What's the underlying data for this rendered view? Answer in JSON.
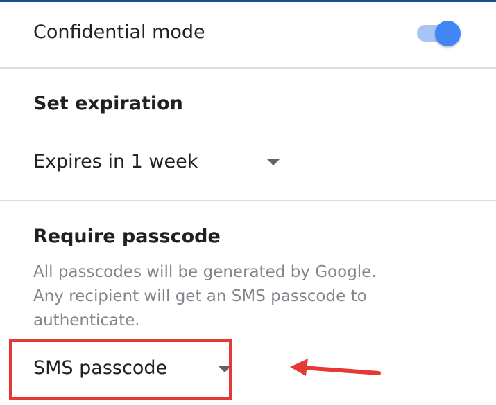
{
  "confidential_mode": {
    "label": "Confidential mode",
    "enabled": true
  },
  "expiration": {
    "title": "Set expiration",
    "selected": "Expires in 1 week"
  },
  "passcode": {
    "title": "Require passcode",
    "description_lines": [
      "All passcodes will be generated by Google.",
      "Any recipient will get an SMS passcode to",
      "authenticate."
    ],
    "selected": "SMS passcode"
  },
  "colors": {
    "accent": "#4285f4",
    "accent_track": "#a7c4f5",
    "annotation": "#e53935",
    "secondary_text": "#80868b",
    "divider": "#dadce0"
  },
  "icons": {
    "dropdown": "caret-down-icon",
    "annotation": "arrow-left-icon"
  }
}
